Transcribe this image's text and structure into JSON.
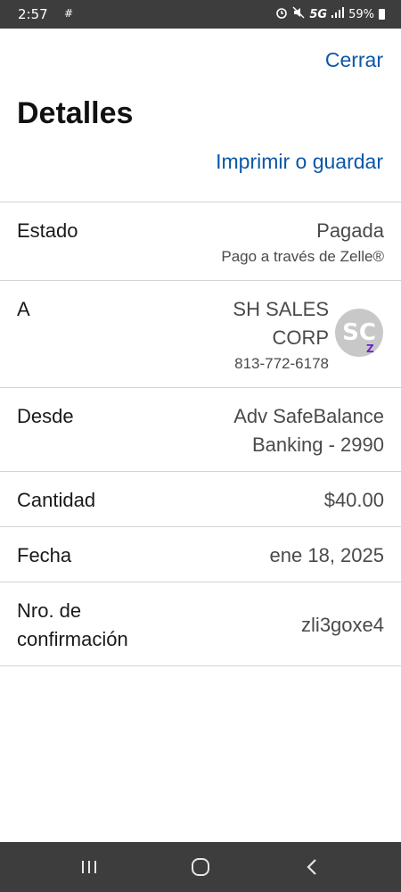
{
  "status_bar": {
    "time": "2:57",
    "notification_icon": "#",
    "network": "5G",
    "battery": "59%"
  },
  "header": {
    "close_label": "Cerrar",
    "title": "Detalles",
    "print_label": "Imprimir o guardar"
  },
  "details": {
    "estado": {
      "label": "Estado",
      "value": "Pagada",
      "sub": "Pago a través de Zelle®"
    },
    "a": {
      "label": "A",
      "name_line1": "SH SALES",
      "name_line2": "CORP",
      "phone": "813-772-6178",
      "avatar_initials": "SC",
      "zelle_badge": "Z"
    },
    "desde": {
      "label": "Desde",
      "value_line1": "Adv SafeBalance",
      "value_line2": "Banking - 2990"
    },
    "cantidad": {
      "label": "Cantidad",
      "value": "$40.00"
    },
    "fecha": {
      "label": "Fecha",
      "value": "ene 18, 2025"
    },
    "confirmacion": {
      "label_line1": "Nro. de",
      "label_line2": "confirmación",
      "value": "zli3goxe4"
    }
  },
  "colors": {
    "link": "#0a57a8",
    "zelle_purple": "#6d1ed4",
    "system_bar": "#3d3d3d",
    "divider": "#d4d4d4"
  },
  "icons": {
    "alarm": "alarm-icon",
    "mute": "mute-icon",
    "signal": "signal-icon",
    "battery": "battery-icon"
  }
}
